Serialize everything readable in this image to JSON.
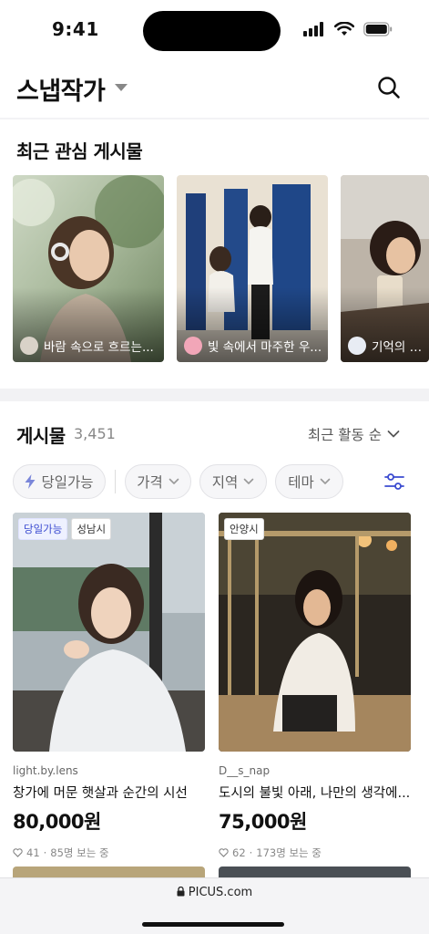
{
  "status": {
    "time": "9:41"
  },
  "header": {
    "title": "스냅작가",
    "title_caret_icon": "caret-down-icon",
    "search_icon": "search-icon"
  },
  "recent": {
    "section_title": "최근 관심 게시물",
    "cards": [
      {
        "caption": "바람 속으로 흐르는...",
        "avatar_color": "#d9d2c8"
      },
      {
        "caption": "빛 속에서 마주한 우...",
        "avatar_color": "#f2a6b8"
      },
      {
        "caption": "기억의 물결",
        "avatar_color": "#e8ecf4"
      }
    ]
  },
  "posts": {
    "title": "게시물",
    "count": "3,451",
    "sort_label": "최근 활동 순",
    "chips": {
      "instant": "당일가능",
      "price": "가격",
      "region": "지역",
      "theme": "테마"
    },
    "filter_icon": "sliders-icon",
    "items": [
      {
        "badges": [
          "당일가능",
          "성남시"
        ],
        "author": "light.by.lens",
        "title": "창가에 머문 햇살과 순간의 시선",
        "price": "80,000원",
        "likes": "41",
        "viewers": "85명 보는 중"
      },
      {
        "badges": [
          "안양시"
        ],
        "author": "D__s_nap",
        "title": "도시의 불빛 아래, 나만의 생각에...",
        "price": "75,000원",
        "likes": "62",
        "viewers": "173명 보는 중"
      }
    ]
  },
  "browser": {
    "url": "PICUS.com",
    "lock_icon": "lock-icon"
  },
  "colors": {
    "accent": "#3b4bd0",
    "badge_bg": "#eef1ff"
  }
}
